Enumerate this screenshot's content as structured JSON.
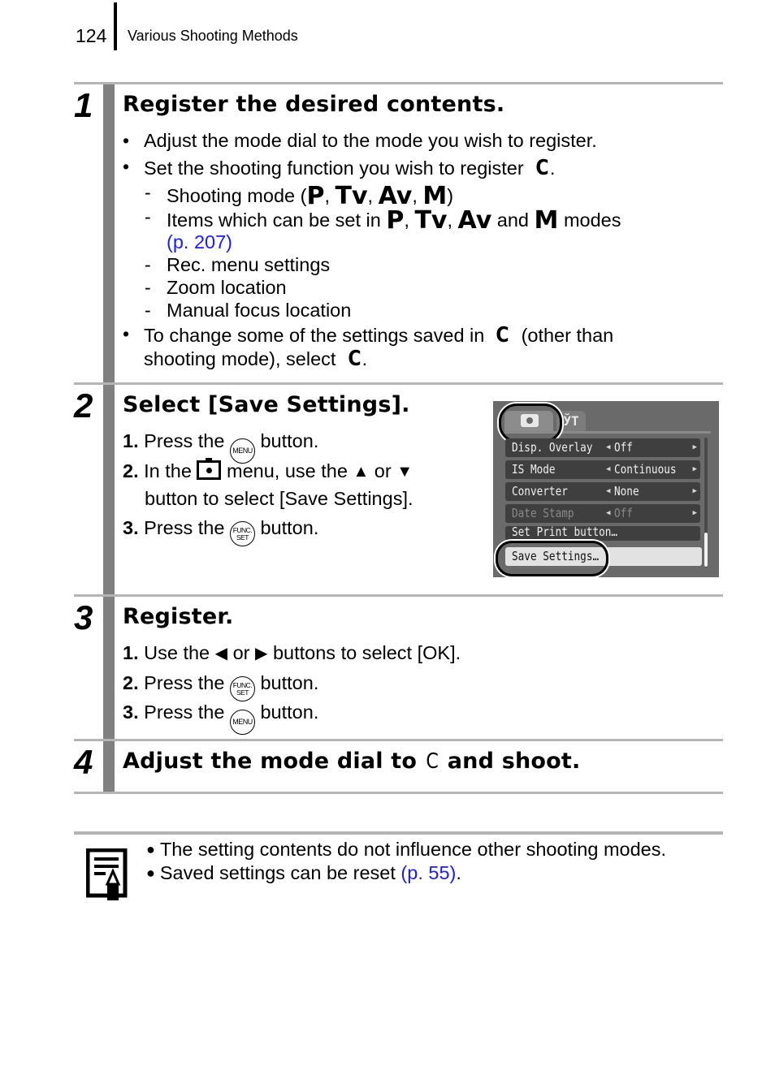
{
  "header": {
    "page_number": "124",
    "section_title": "Various Shooting Methods"
  },
  "steps": [
    {
      "number": "1",
      "title": "Register the desired contents.",
      "bullets": {
        "b1": "Adjust the mode dial to the mode you wish to register.",
        "b2_text": "Set the shooting function you wish to register",
        "b2_end": ".",
        "sub1_pre": "Shooting mode (",
        "sub1_post": ")",
        "sub2_pre": "Items which can be set in",
        "sub2_and": "and",
        "sub2_post": "modes",
        "sub2_link": "(p. 207)",
        "sub3": "Rec. menu settings",
        "sub4": "Zoom location",
        "sub5": "Manual focus location",
        "b3_pre": "To change some of the settings saved in",
        "b3_mid": "(other than",
        "b3_line2": "shooting mode), select",
        "b3_end": "."
      }
    },
    {
      "number": "2",
      "title": "Select [Save Settings].",
      "items": [
        {
          "num": "1.",
          "pre": "Press the",
          "icon": "MENU",
          "post": "button."
        },
        {
          "num": "2.",
          "pre": "In the",
          "mid": "menu, use the",
          "or": "or",
          "line2": "button to select [Save Settings]."
        },
        {
          "num": "3.",
          "pre": "Press the",
          "icon": "FUNC. SET",
          "post": "button."
        }
      ]
    },
    {
      "number": "3",
      "title": "Register.",
      "items": [
        {
          "num": "1.",
          "pre": "Use the",
          "or": "or",
          "post": "buttons to select [OK]."
        },
        {
          "num": "2.",
          "pre": "Press the",
          "icon": "FUNC. SET",
          "post": "button."
        },
        {
          "num": "3.",
          "pre": "Press the",
          "icon": "MENU",
          "post": "button."
        }
      ]
    },
    {
      "number": "4",
      "title_pre": "Adjust the mode dial to",
      "title_post": "and shoot."
    }
  ],
  "symbols": {
    "custom_mode": "C",
    "modes": [
      "P",
      "Tv",
      "Av",
      "M"
    ],
    "comma": ",",
    "bullet": "•",
    "dash": "-",
    "arrow_up": "🡅",
    "arrow_down": "🡇",
    "arrow_left": "🡄",
    "arrow_right": "🡆",
    "menu_btn": "MENU",
    "func_btn_top": "FUNC.",
    "func_btn_bottom": "SET"
  },
  "lcd_screen": {
    "tabs": [
      {
        "icon": "camera-icon",
        "selected": true
      },
      {
        "icon": "tools-icon",
        "glyph": "ЎТ"
      }
    ],
    "rows": [
      {
        "label": "Disp. Overlay",
        "value": "Off",
        "arrows": true,
        "dimmed": false
      },
      {
        "label": "IS Mode",
        "value": "Continuous",
        "arrows": true,
        "dimmed": false
      },
      {
        "label": "Converter",
        "value": "None",
        "arrows": true,
        "dimmed": false
      },
      {
        "label": "Date Stamp",
        "value": "Off",
        "arrows": true,
        "dimmed": true
      },
      {
        "label": "Set Print button…",
        "value": "",
        "arrows": false,
        "dimmed": false
      },
      {
        "label": "Save Settings…",
        "value": "",
        "arrows": false,
        "selected": true
      }
    ],
    "arrow_left": "◀",
    "arrow_right": "▶"
  },
  "note": {
    "items": [
      {
        "text": "The setting contents do not influence other shooting modes."
      },
      {
        "text": "Saved settings can be reset ",
        "link": "(p. 55)",
        "end": "."
      }
    ],
    "bullet": "●"
  },
  "colors": {
    "link": "#1a1aff",
    "rule": "#b4b4b4",
    "gutter": "#808080"
  }
}
